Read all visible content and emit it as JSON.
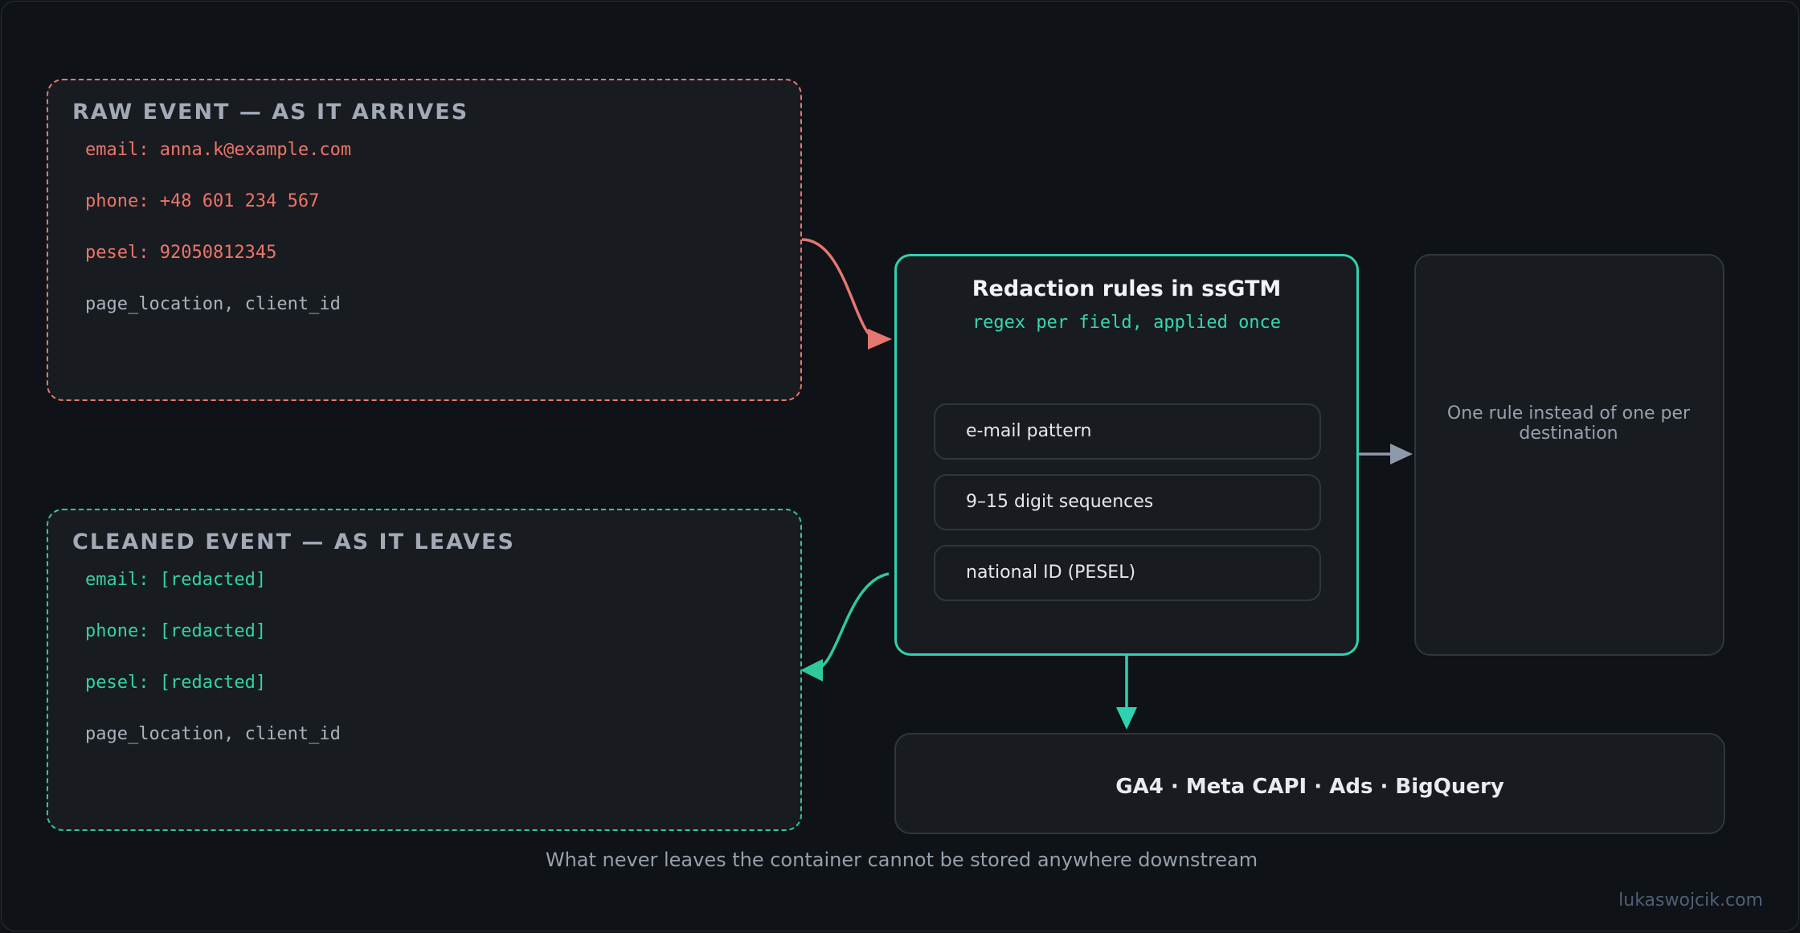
{
  "raw_panel": {
    "title": "RAW EVENT — AS IT ARRIVES",
    "fields": [
      "email: anna.k@example.com",
      "phone: +48 601 234 567",
      "pesel: 92050812345",
      "page_location, client_id"
    ]
  },
  "cleaned_panel": {
    "title": "CLEANED EVENT — AS IT LEAVES",
    "fields": [
      "email: [redacted]",
      "phone: [redacted]",
      "pesel: [redacted]",
      "page_location, client_id"
    ]
  },
  "rules_box": {
    "title": "Redaction rules in ssGTM",
    "subtitle": "regex per field, applied once",
    "rules": [
      "e-mail pattern",
      "9–15 digit sequences",
      "national ID (PESEL)"
    ]
  },
  "note": "One rule instead of one per destination",
  "destinations": "GA4 · Meta CAPI · Ads · BigQuery",
  "caption": "What never leaves the container cannot be stored anywhere downstream",
  "credit": "lukaswojcik.com",
  "colors": {
    "raw": "#e6776f",
    "clean": "#2fc99b",
    "rules_border": "#2fd2ae",
    "neutral_arrow": "#8e99aa"
  }
}
